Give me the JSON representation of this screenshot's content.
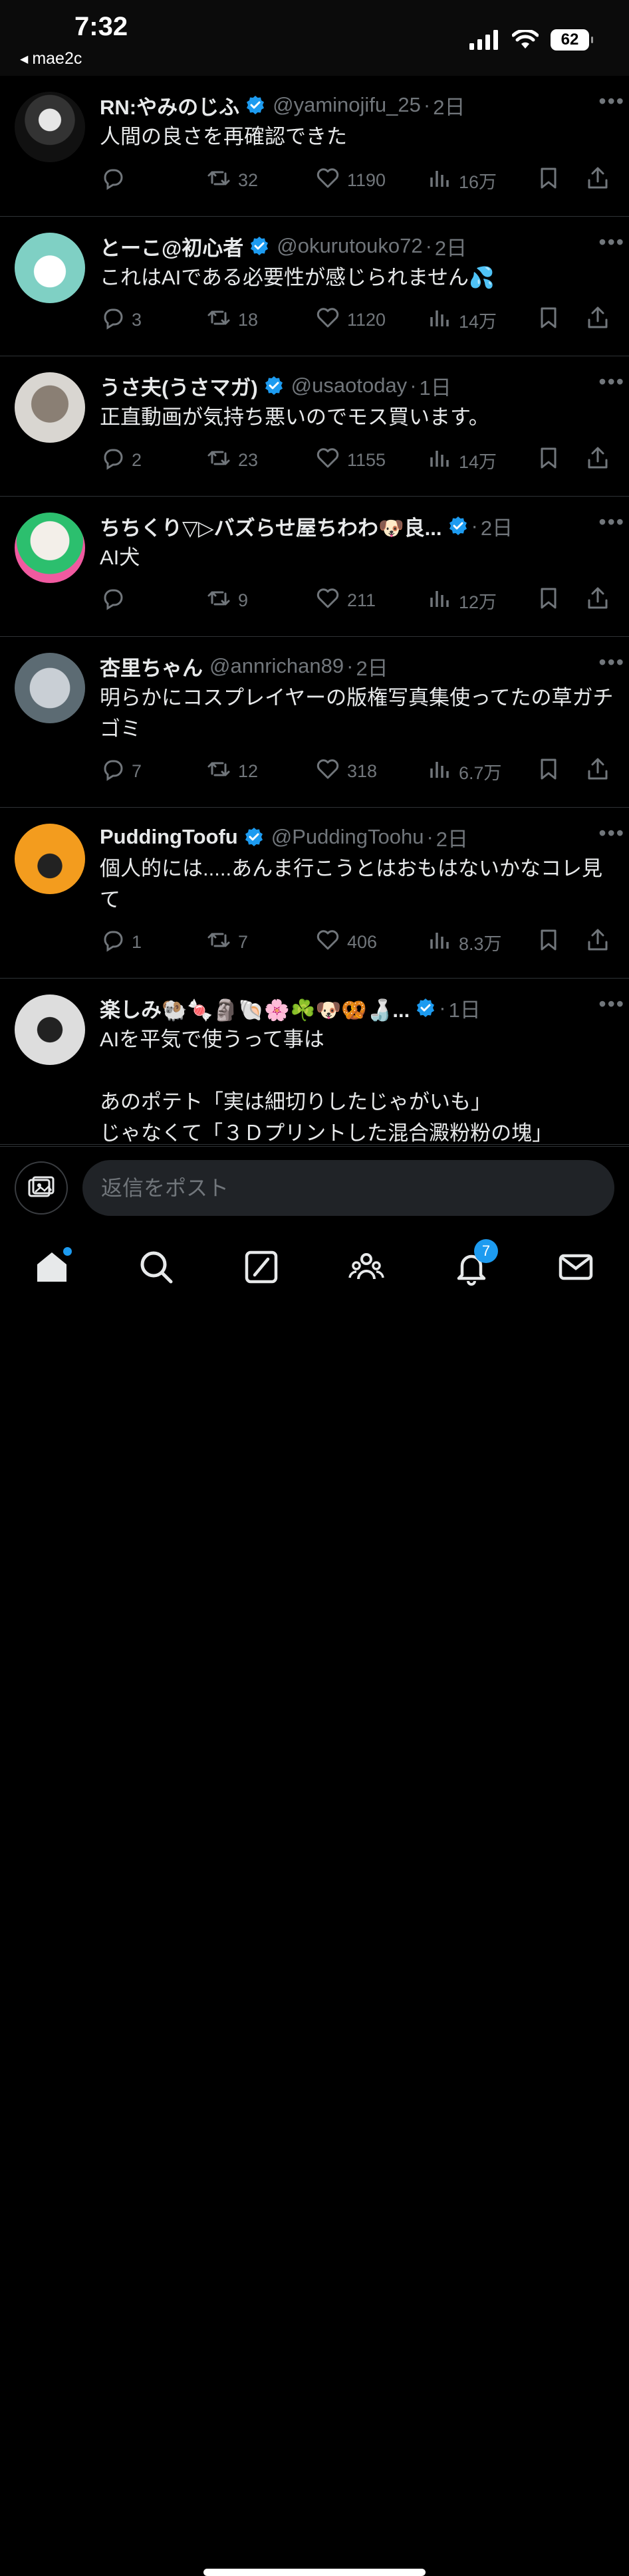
{
  "status_bar": {
    "time": "7:32",
    "back_label": "mae2c",
    "battery": "62"
  },
  "tweets": [
    {
      "name": "RN:やみのじふ",
      "handle": "@yaminojifu_25",
      "time": "2日",
      "text": "人間の良さを再確認できた",
      "replies": "",
      "retweets": "32",
      "likes": "1190",
      "views": "16万"
    },
    {
      "name": "とーこ@初心者",
      "handle": "@okurutouko72",
      "time": "2日",
      "text": "これはAIである必要性が感じられません💦",
      "replies": "3",
      "retweets": "18",
      "likes": "1120",
      "views": "14万"
    },
    {
      "name": "うさ夫(うさマガ)",
      "handle": "@usaotoday",
      "time": "1日",
      "text": "正直動画が気持ち悪いのでモス買います。",
      "replies": "2",
      "retweets": "23",
      "likes": "1155",
      "views": "14万"
    },
    {
      "name": "ちちくり▽▷バズらせ屋ちわわ🐶良...",
      "handle": "",
      "time": "2日",
      "text": "AI犬",
      "replies": "",
      "retweets": "9",
      "likes": "211",
      "views": "12万"
    },
    {
      "name": "杏里ちゃん",
      "handle": "@annrichan89",
      "time": "2日",
      "text": "明らかにコスプレイヤーの版権写真集使ってたの草ガチゴミ",
      "replies": "7",
      "retweets": "12",
      "likes": "318",
      "views": "6.7万"
    },
    {
      "name": "PuddingToofu",
      "handle": "@PuddingToohu",
      "time": "2日",
      "text": "個人的には.....あんま行こうとはおもはないかなコレ見て",
      "replies": "1",
      "retweets": "7",
      "likes": "406",
      "views": "8.3万"
    },
    {
      "name": "楽しみ🐏🍬🗿🐚🌸☘️🐶🥨🍶...",
      "handle": "",
      "time": "1日",
      "text": "AIを平気で使うって事は\n\nあのポテト「実は細切りしたじゃがいも」\nじゃなくて「３Ｄプリントした混合澱粉粉の塊」",
      "replies": "",
      "retweets": "",
      "likes": "",
      "views": ""
    }
  ],
  "reply_bar": {
    "placeholder": "返信をポスト"
  },
  "tab_bar": {
    "notifications_badge": "7"
  },
  "colors": {
    "accent": "#1d9bf0",
    "muted": "#71767b",
    "background": "#000000",
    "divider": "#2f3336"
  }
}
